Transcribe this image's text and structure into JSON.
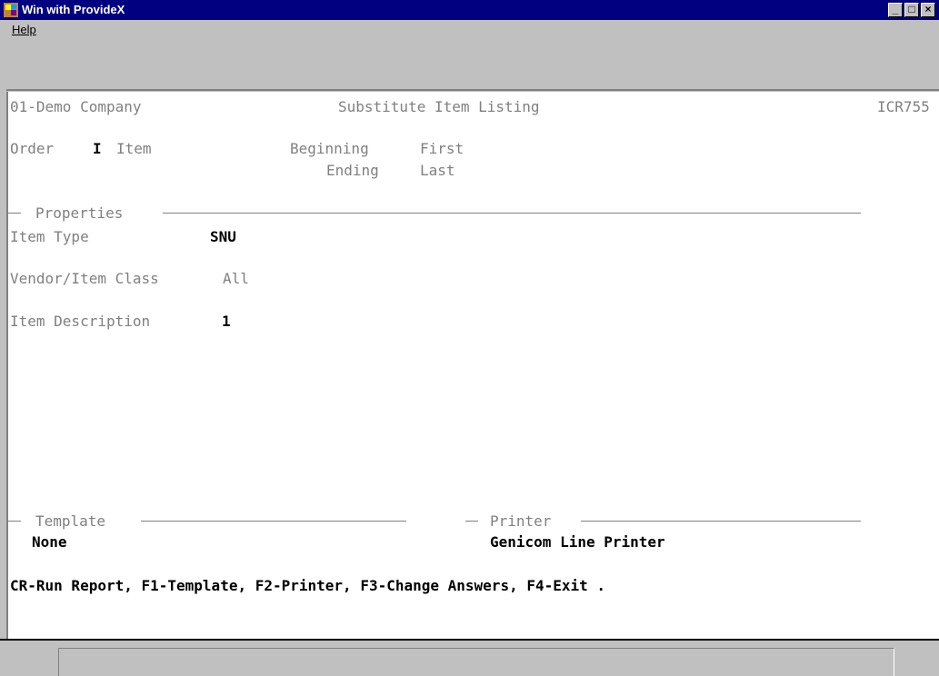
{
  "window": {
    "title": "Win with ProvideX",
    "icon": "providex-app-icon",
    "minimize_glyph": "_",
    "maximize_glyph": "□",
    "close_glyph": "×"
  },
  "menu": {
    "help_label": "Help"
  },
  "report": {
    "company": "01-Demo Company",
    "title": "Substitute Item Listing",
    "code": "ICR755",
    "order_label": "Order",
    "order_value": "I",
    "order_field": "Item",
    "beginning_label": "Beginning",
    "beginning_value": "First",
    "ending_label": "Ending",
    "ending_value": "Last"
  },
  "properties": {
    "section_label": "Properties",
    "item_type_label": "Item Type",
    "item_type_value": "SNU",
    "vendor_class_label": "Vendor/Item Class",
    "vendor_class_value": "All",
    "item_desc_label": "Item Description",
    "item_desc_value": "1"
  },
  "template": {
    "section_label": "Template",
    "value": "None"
  },
  "printer": {
    "section_label": "Printer",
    "value": "Genicom Line Printer"
  },
  "prompt": "CR-Run Report, F1-Template, F2-Printer, F3-Change Answers, F4-Exit .",
  "colors": {
    "titlebar": "#000080",
    "label": "#808080",
    "value": "#000000"
  }
}
